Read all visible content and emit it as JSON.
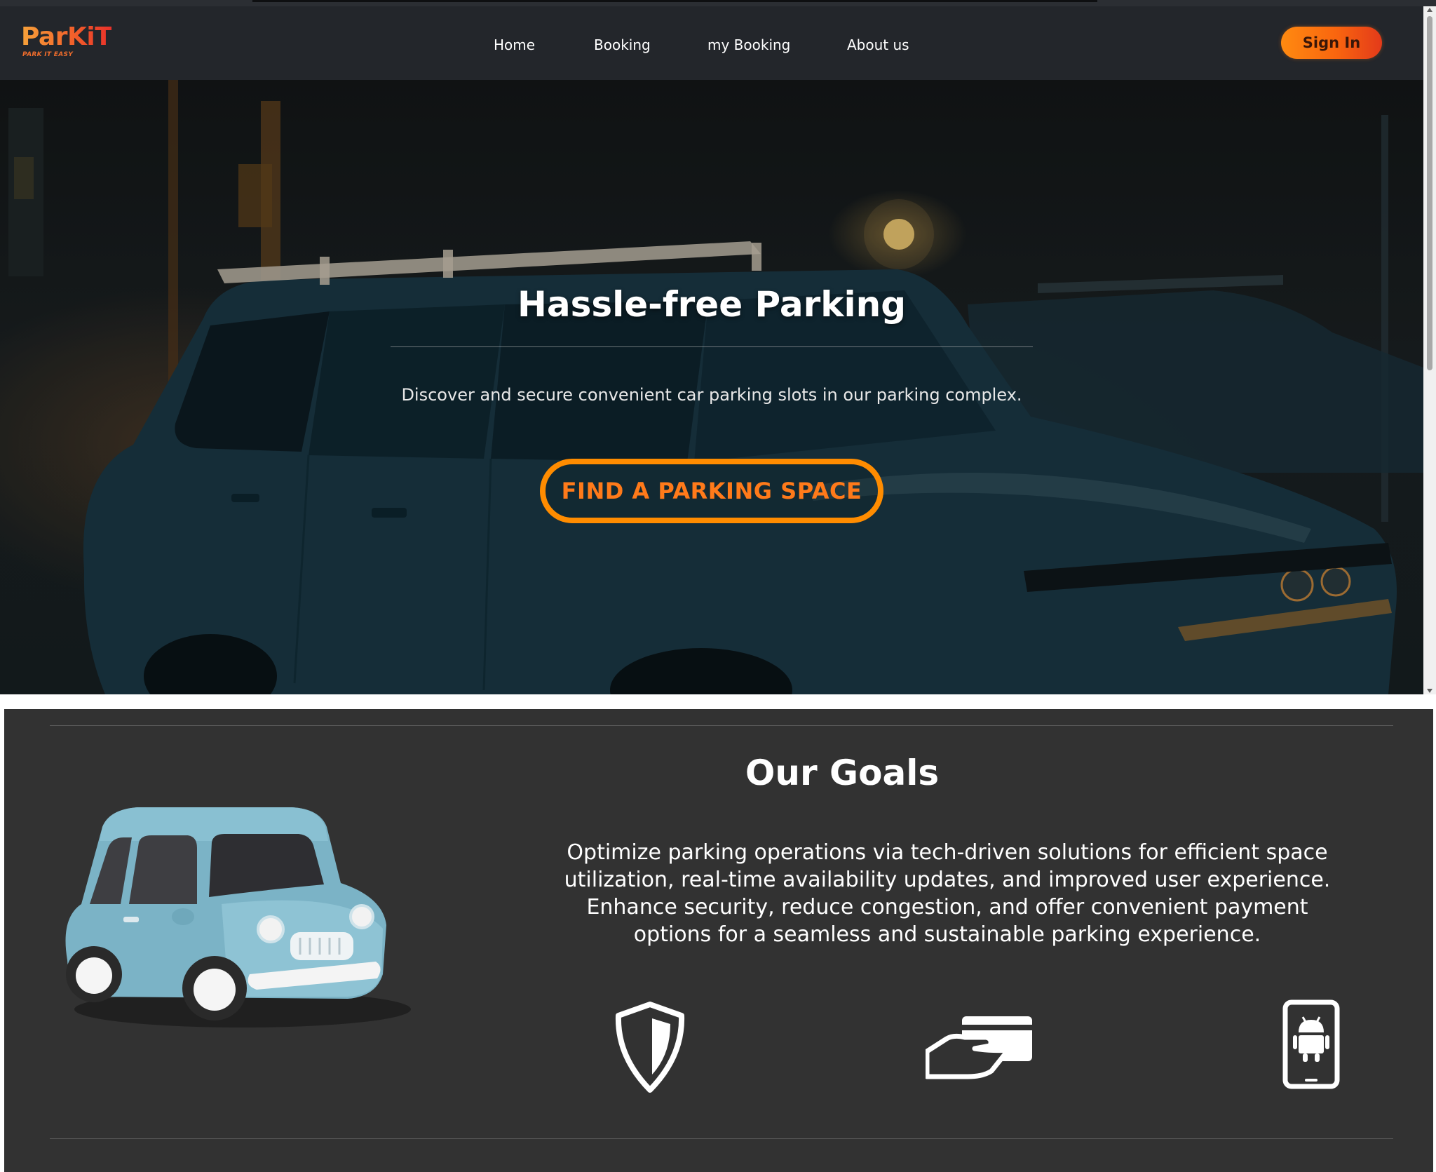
{
  "brand": {
    "name": "ParKiT",
    "tagline": "PARK IT EASY"
  },
  "nav": {
    "items": [
      {
        "label": "Home"
      },
      {
        "label": "Booking"
      },
      {
        "label": "my Booking"
      },
      {
        "label": "About us"
      }
    ],
    "signin_label": "Sign In"
  },
  "hero": {
    "title": "Hassle-free Parking",
    "subtitle": "Discover and secure convenient car parking slots in our parking complex.",
    "cta_label": "FIND A PARKING SPACE"
  },
  "goals": {
    "title": "Our Goals",
    "text": "Optimize parking operations via tech-driven solutions for efficient space utilization, real-time availability updates, and improved user experience. Enhance security, reduce congestion, and offer convenient payment options for a seamless and sustainable parking experience.",
    "icons": [
      "shield-icon",
      "payment-card-icon",
      "android-phone-icon"
    ]
  },
  "colors": {
    "accent_orange": "#ff8c00",
    "cta_text": "#ff7a1a",
    "nav_bg": "#23262b",
    "goals_bg": "#323232"
  }
}
